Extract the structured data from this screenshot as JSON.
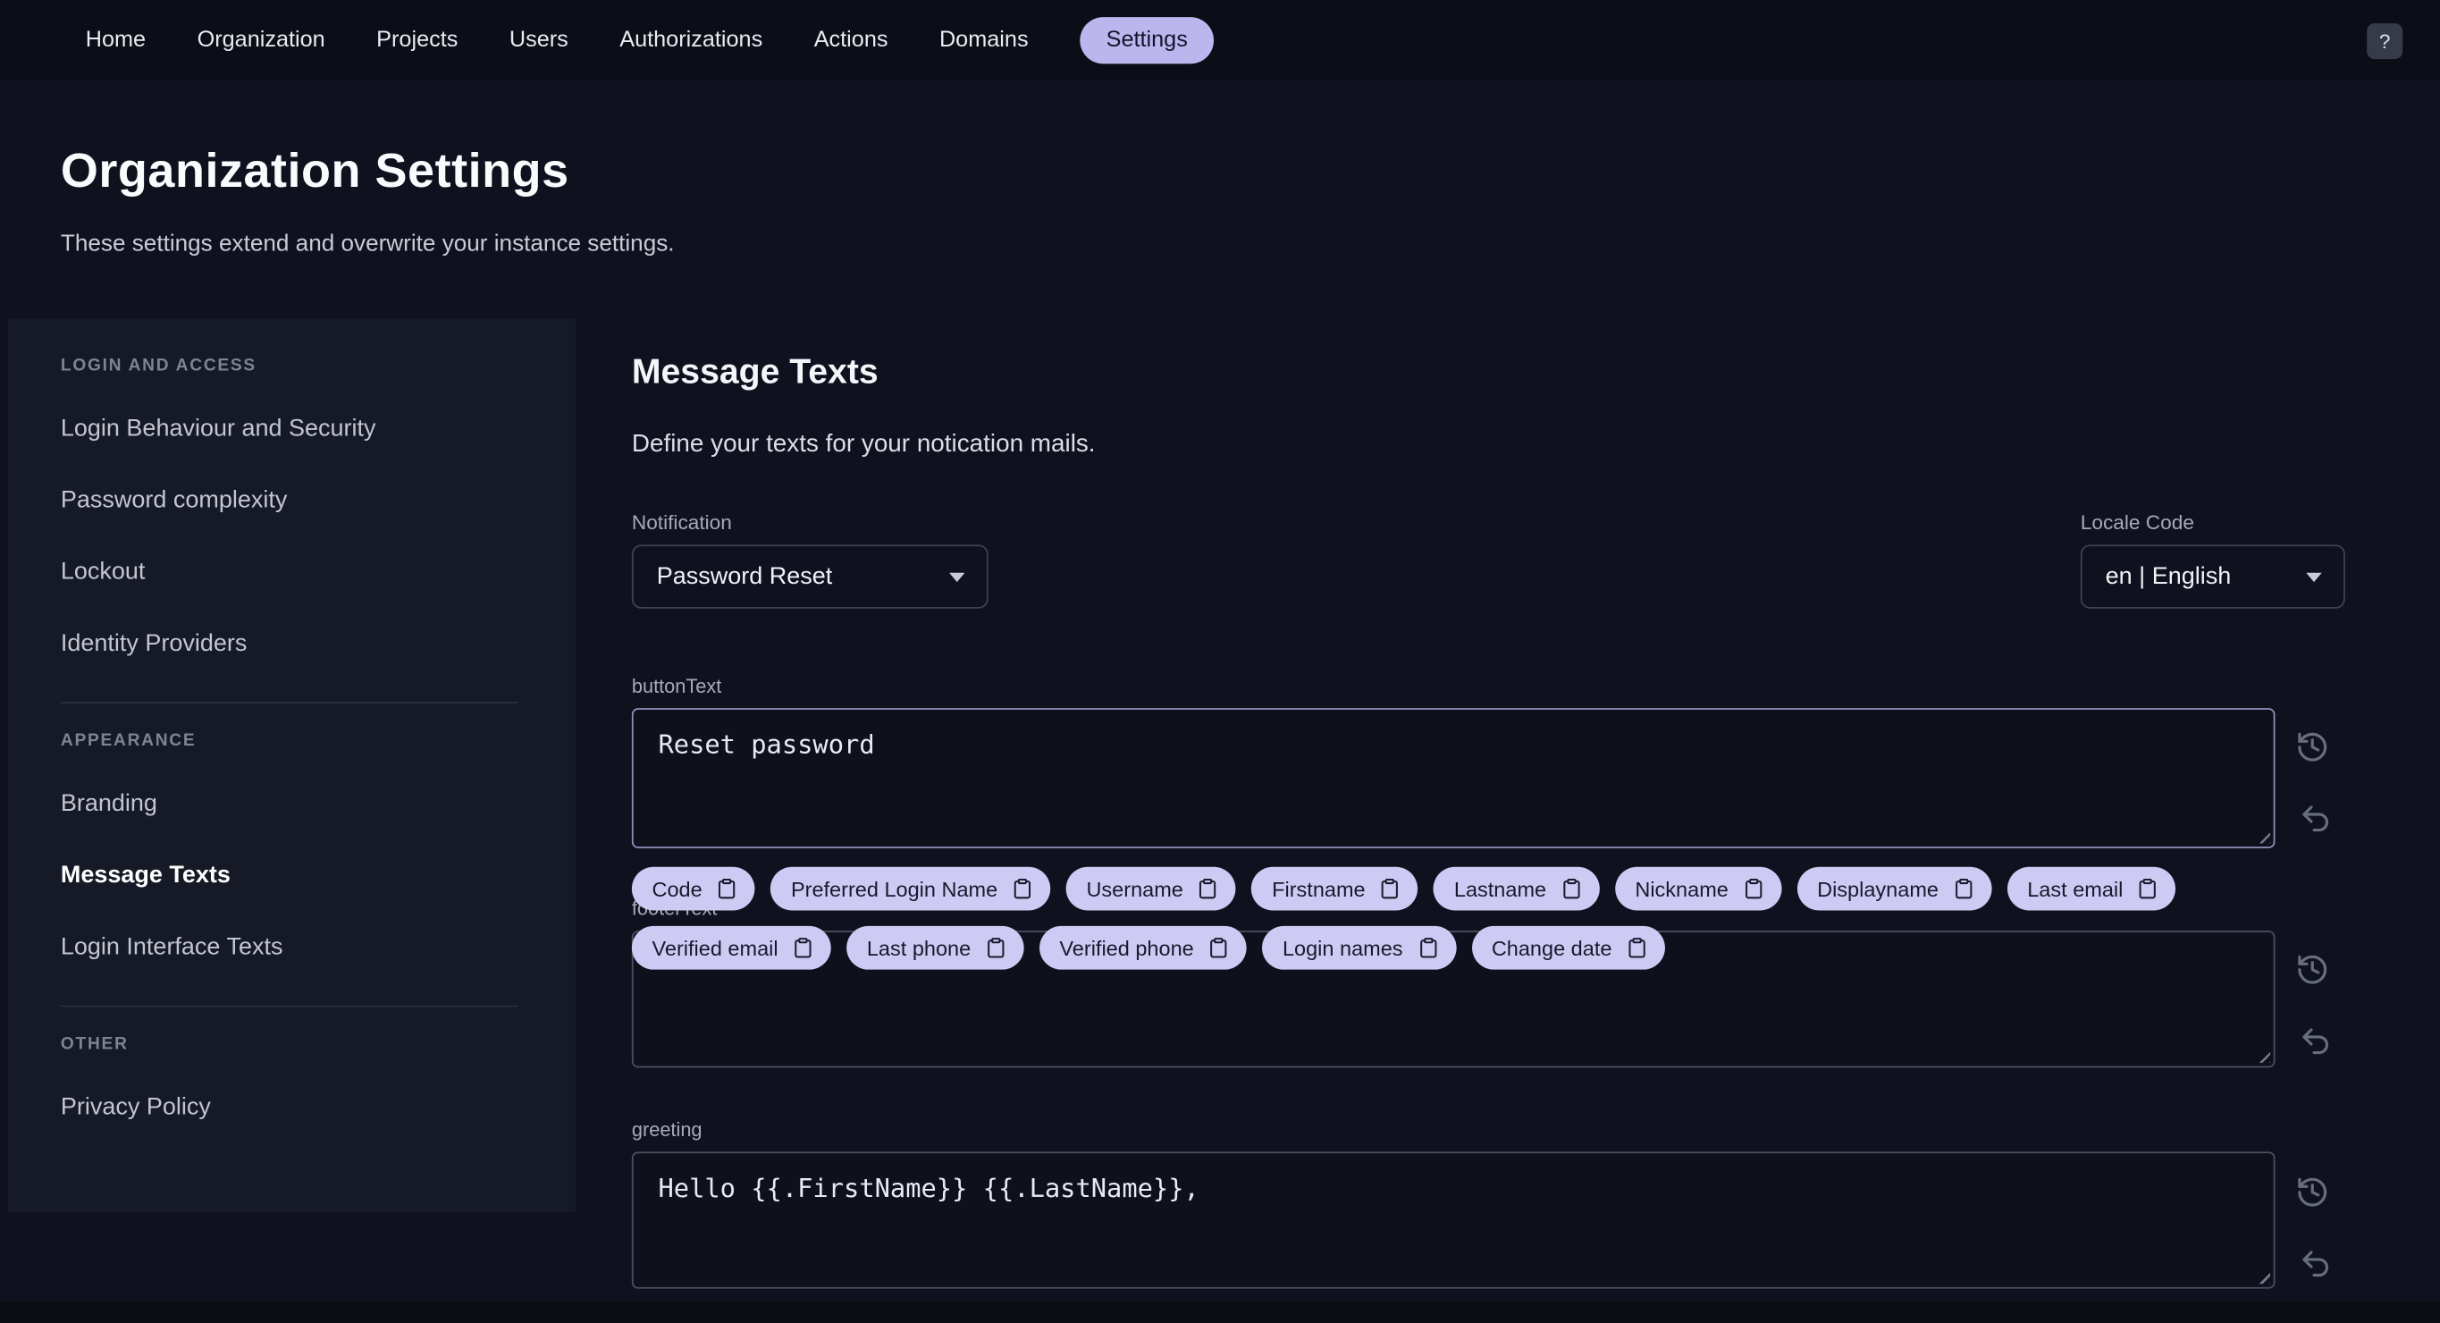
{
  "topnav": {
    "items": [
      "Home",
      "Organization",
      "Projects",
      "Users",
      "Authorizations",
      "Actions",
      "Domains",
      "Settings"
    ],
    "active_item": "Settings",
    "help_label": "?"
  },
  "header": {
    "title": "Organization Settings",
    "subtitle": "These settings extend and overwrite your instance settings."
  },
  "sidebar": {
    "sections": [
      {
        "title": "LOGIN AND ACCESS",
        "items": [
          "Login Behaviour and Security",
          "Password complexity",
          "Lockout",
          "Identity Providers"
        ]
      },
      {
        "title": "APPEARANCE",
        "items": [
          "Branding",
          "Message Texts",
          "Login Interface Texts"
        ]
      },
      {
        "title": "OTHER",
        "items": [
          "Privacy Policy"
        ]
      }
    ],
    "active_item": "Message Texts"
  },
  "main": {
    "title": "Message Texts",
    "description": "Define your texts for your notication mails.",
    "notification_label": "Notification",
    "notification_value": "Password Reset",
    "locale_label": "Locale Code",
    "locale_value": "en | English",
    "button_text": {
      "label": "buttonText",
      "value": "Reset password"
    },
    "footer_text": {
      "label": "footerText",
      "value": ""
    },
    "greeting": {
      "label": "greeting",
      "value": "Hello {{.FirstName}} {{.LastName}},"
    },
    "chips": [
      "Code",
      "Preferred Login Name",
      "Username",
      "Firstname",
      "Lastname",
      "Nickname",
      "Displayname",
      "Last email",
      "Verified email",
      "Last phone",
      "Verified phone",
      "Login names",
      "Change date"
    ]
  },
  "colors": {
    "accent": "#bcb6ee",
    "page_bg": "#0f121e",
    "panel_bg": "#161a27",
    "chip_bg": "#cfcaf4"
  }
}
